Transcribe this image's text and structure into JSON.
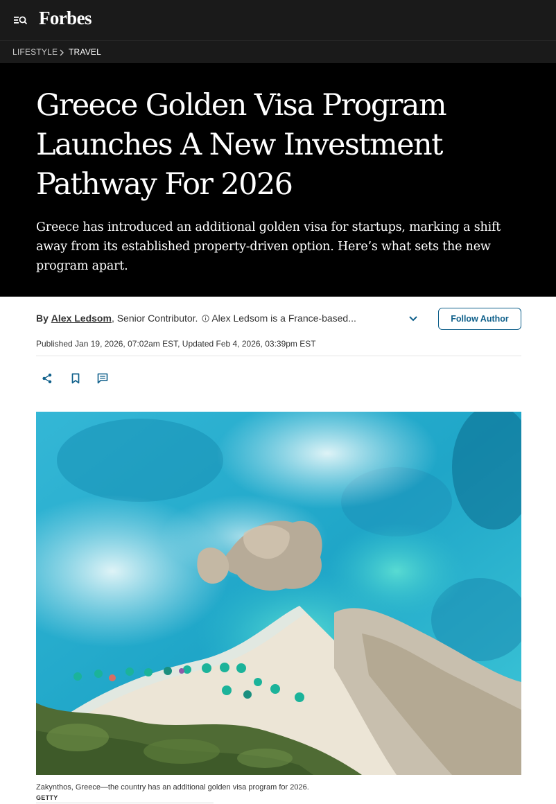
{
  "header": {
    "logo": "Forbes",
    "menu_icon": "menu-search-icon"
  },
  "breadcrumb": {
    "section": "LIFESTYLE",
    "separator_icon": "chevron-right-icon",
    "subsection": "TRAVEL"
  },
  "article": {
    "headline": "Greece Golden Visa Program Launches A New Investment Pathway For 2026",
    "dek": "Greece has introduced an additional golden visa for startups, marking a shift away from its established property-driven option. Here’s what sets the new program apart."
  },
  "byline": {
    "prefix": "By",
    "author": "Alex Ledsom",
    "role": ", Senior Contributor.",
    "bio": "Alex Ledsom is a France-based...",
    "follow_label": "Follow Author",
    "published": "Published Jan 19, 2026, 07:02am EST, Updated Feb 4, 2026, 03:39pm EST"
  },
  "actions": {
    "share_icon": "share-icon",
    "bookmark_icon": "bookmark-icon",
    "comment_icon": "comment-icon"
  },
  "image": {
    "caption": "Zakynthos, Greece—the country has an additional golden visa program for 2026.",
    "credit": "GETTY"
  },
  "colors": {
    "header_bg": "#1a1a1a",
    "hero_bg": "#000000",
    "accent": "#0e5f8a"
  }
}
